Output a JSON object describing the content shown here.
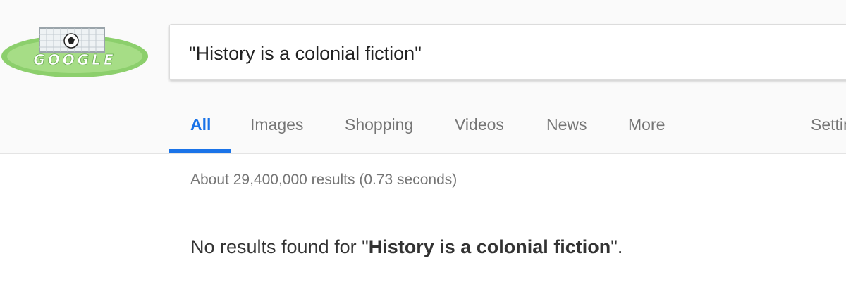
{
  "colors": {
    "accent": "#1a73e8",
    "tab_text": "#757575",
    "header_bg": "#fafafa",
    "body_text": "#333333"
  },
  "logo": {
    "text": "GOOGLE",
    "icon": "soccer-doodle-logo"
  },
  "search": {
    "value": "\"History is a colonial fiction\""
  },
  "tabs": [
    {
      "label": "All",
      "active": true
    },
    {
      "label": "Images",
      "active": false
    },
    {
      "label": "Shopping",
      "active": false
    },
    {
      "label": "Videos",
      "active": false
    },
    {
      "label": "News",
      "active": false
    },
    {
      "label": "More",
      "active": false
    },
    {
      "label": "Settings",
      "active": false
    }
  ],
  "results": {
    "stats": "About 29,400,000 results (0.73 seconds)",
    "no_results_prefix": "No results found for \"",
    "no_results_query": "History is a colonial fiction",
    "no_results_suffix": "\"."
  }
}
